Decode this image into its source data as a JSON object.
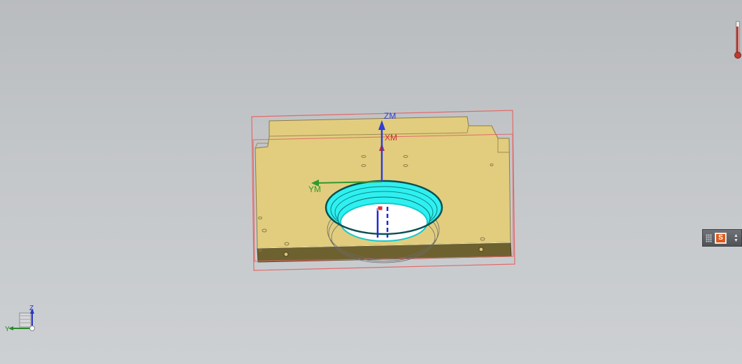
{
  "viewport": {
    "background": "#c4c7ca",
    "part_color": "#e2cd7e",
    "part_front_color": "#6e6130",
    "bounding_box_color": "#e26a6a",
    "hole_highlight_color": "#2ff0f0"
  },
  "work_coordinate_system": {
    "z_label": "ZM",
    "x_label": "XM",
    "y_label": "YM",
    "z_color": "#2f3fd4",
    "x_color": "#cf3030",
    "y_color": "#2f9a2f"
  },
  "view_triad": {
    "z_label": "Z",
    "y_label": "Y"
  },
  "mini_toolbar": {
    "icon": "s-icon",
    "button_label": "S"
  },
  "status_indicator": {
    "icon": "thermometer-icon"
  }
}
